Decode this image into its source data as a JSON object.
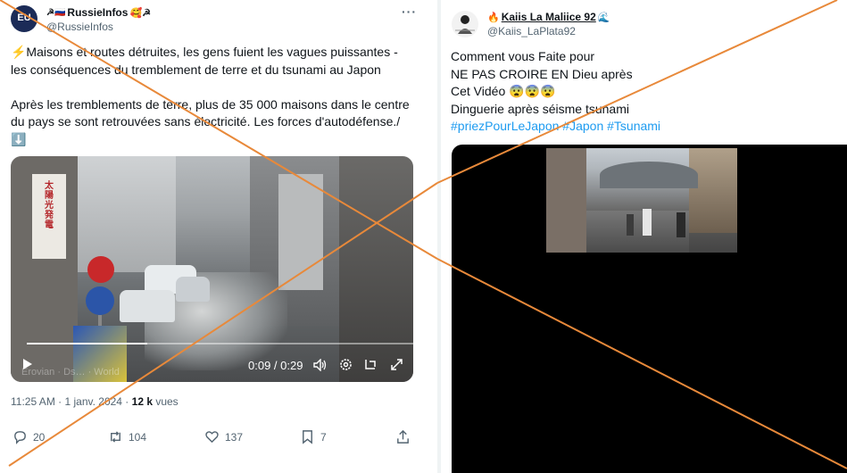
{
  "left_tweet": {
    "author_name": "RussieInfos",
    "author_handle": "@RussieInfos",
    "avatar_label": "EU",
    "text_line1": "⚡Maisons et routes détruites, les gens fuient les vagues puissantes -",
    "text_line2": "les conséquences du tremblement de terre et du tsunami au Japon",
    "text_line3": "Après les tremblements de terre, plus de 35 000 maisons dans le centre",
    "text_line4": "du pays se sont retrouvées sans électricité. Les forces d'autodéfense./",
    "text_line5": "⬇️",
    "video": {
      "time": "0:09 / 0:29",
      "progress": 0.31,
      "watermark": "Erovian · Ds… · World"
    },
    "timestamp": "11:25 AM · 1 janv. 2024 · ",
    "views_count": "12 k",
    "views_label": " vues",
    "replies": "20",
    "reposts": "104",
    "likes": "137",
    "bookmarks": "7"
  },
  "right_tweet": {
    "author_name": "Kaiis La Maliice 92",
    "author_handle": "@Kaiis_LaPlata92",
    "text_line1": "Comment vous Faite pour",
    "text_line2": "NE PAS CROIRE EN Dieu après",
    "text_line3": "Cet Vidéo  😨😨😨",
    "text_line4": "Dinguerie après séisme tsunami",
    "hashtags": "#priezPourLeJapon #Japon #Tsunami"
  },
  "overlay": {
    "cross_color": "#e8893a"
  },
  "colors": {
    "accent": "#1d9bf0",
    "muted": "#536471",
    "text": "#0f1419"
  }
}
